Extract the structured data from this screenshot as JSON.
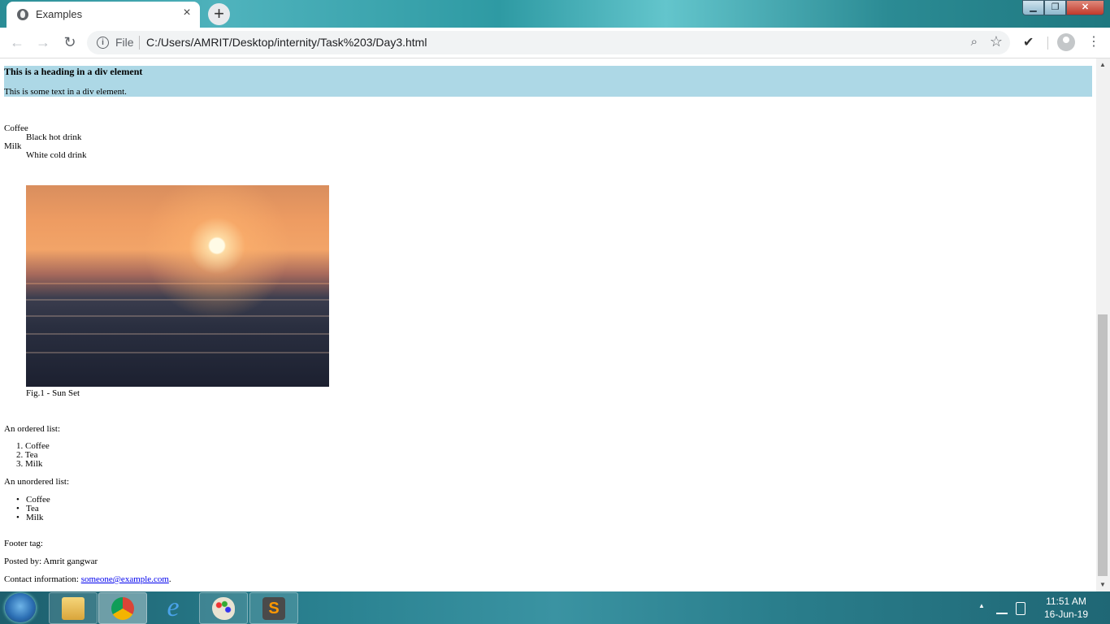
{
  "browser": {
    "tab_title": "Examples",
    "close_tab_glyph": "×",
    "new_tab_glyph": "+",
    "window_controls": {
      "minimize": "▁",
      "maximize": "❐",
      "close": "✕"
    },
    "nav": {
      "back": "←",
      "forward": "→",
      "reload": "↻"
    },
    "address": {
      "info_glyph": "i",
      "scheme_label": "File",
      "url": "C:/Users/AMRIT/Desktop/internity/Task%203/Day3.html"
    },
    "zoom_glyph": "⌕",
    "star_glyph": "☆",
    "extension_glyph": "✔",
    "menu_glyph": "⋮"
  },
  "page": {
    "div_heading": "This is a heading in a div element",
    "div_text": "This is some text in a div element.",
    "dl": [
      {
        "term": "Coffee",
        "desc": "Black hot drink"
      },
      {
        "term": "Milk",
        "desc": "White cold drink"
      }
    ],
    "figure": {
      "caption": "Fig.1 - Sun Set",
      "image": "sunset-over-ocean"
    },
    "ordered_label": "An ordered list:",
    "ordered": [
      "1. Coffee",
      "2. Tea",
      "3. Milk"
    ],
    "unordered_label": "An unordered list:",
    "unordered": [
      "Coffee",
      "Tea",
      "Milk"
    ],
    "bullet": "•",
    "footer_label": "Footer tag:",
    "posted_by": "Posted by: Amrit gangwar",
    "contact_prefix": "Contact information: ",
    "contact_email": "someone@example.com",
    "contact_suffix": "."
  },
  "scrollbar": {
    "up": "▲",
    "down": "▼"
  },
  "taskbar": {
    "apps": [
      "windows-explorer",
      "google-chrome",
      "internet-explorer",
      "paint",
      "sublime-text"
    ],
    "tray": {
      "arrow": "▲"
    },
    "time": "11:51 AM",
    "date": "16-Jun-19"
  }
}
